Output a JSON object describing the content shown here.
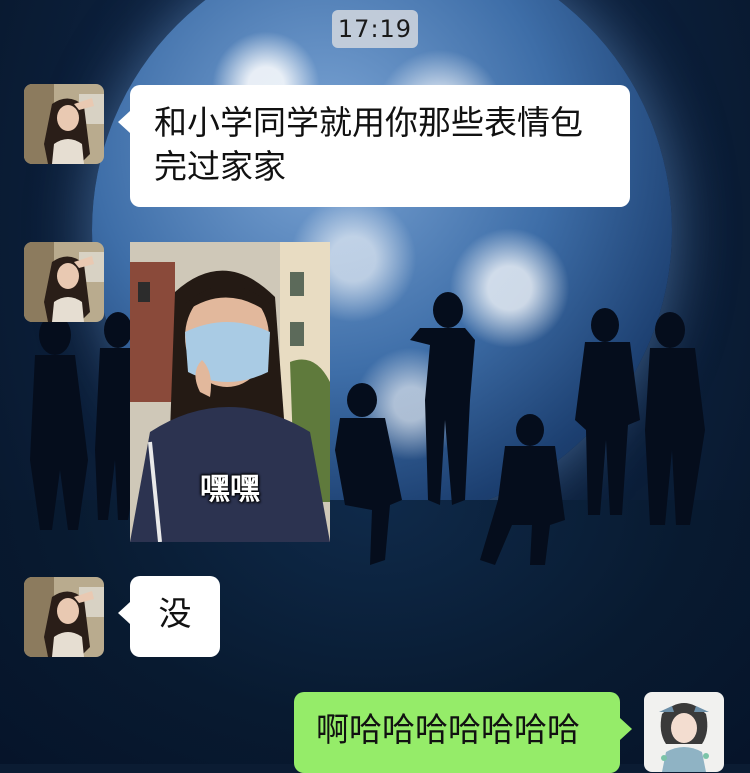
{
  "status": {
    "time": "17:19"
  },
  "messages": [
    {
      "sender": "contact",
      "type": "text",
      "text": "和小学同学就用你那些表情包完过家家"
    },
    {
      "sender": "contact",
      "type": "sticker",
      "caption": "嘿嘿"
    },
    {
      "sender": "contact",
      "type": "text",
      "text": "没"
    },
    {
      "sender": "me",
      "type": "text",
      "text": "啊哈哈哈哈哈哈哈"
    }
  ],
  "colors": {
    "outgoing_bubble": "#95ec69",
    "incoming_bubble": "#ffffff",
    "wallpaper": "#0b1c33"
  },
  "icons": {
    "contact_avatar": "contact-avatar-photo",
    "self_avatar": "self-avatar-illustration"
  }
}
